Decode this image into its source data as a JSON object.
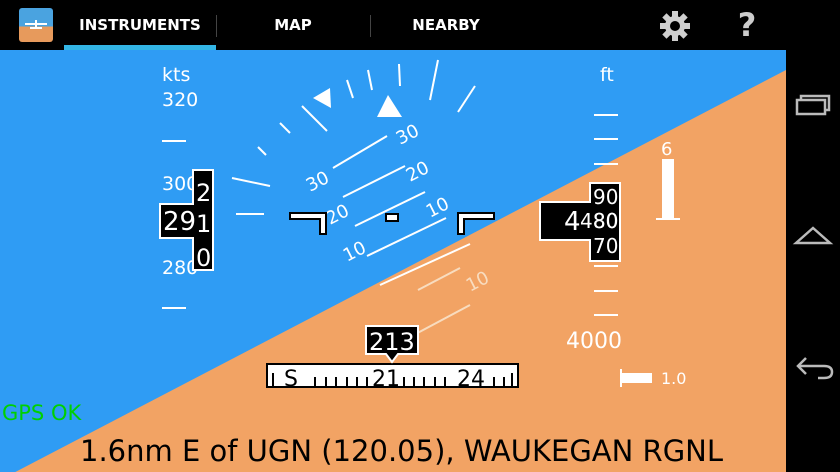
{
  "app": {
    "icon": "app-icon"
  },
  "tabs": [
    {
      "label": "INSTRUMENTS",
      "selected": true
    },
    {
      "label": "MAP"
    },
    {
      "label": "NEARBY"
    }
  ],
  "toolbar": {
    "settings_icon": "gear-icon",
    "help_label": "?"
  },
  "colors": {
    "sky": "#2f9cf4",
    "ground": "#f2a364",
    "accent": "#33b5e5",
    "gps_ok": "#00d000"
  },
  "airspeed": {
    "unit": "kts",
    "top_value": "320",
    "tick_labels": [
      "300",
      "280"
    ],
    "readout_main": "29",
    "readout_digits": [
      "2",
      "1",
      "0"
    ]
  },
  "altitude": {
    "unit": "ft",
    "tick_label_bottom": "4000",
    "readout_main": "4",
    "readout_mid": "480",
    "readout_digits": [
      "90",
      "80",
      "70"
    ]
  },
  "vsi": {
    "top_label": "6",
    "bottom_label": "1.0"
  },
  "pitch_ladder": [
    "30",
    "20",
    "10",
    "10"
  ],
  "heading": {
    "readout": "213",
    "tape_labels": [
      "S",
      "21",
      "24"
    ]
  },
  "status": {
    "gps": "GPS OK",
    "location": "1.6nm E of UGN (120.05), WAUKEGAN RGNL"
  }
}
